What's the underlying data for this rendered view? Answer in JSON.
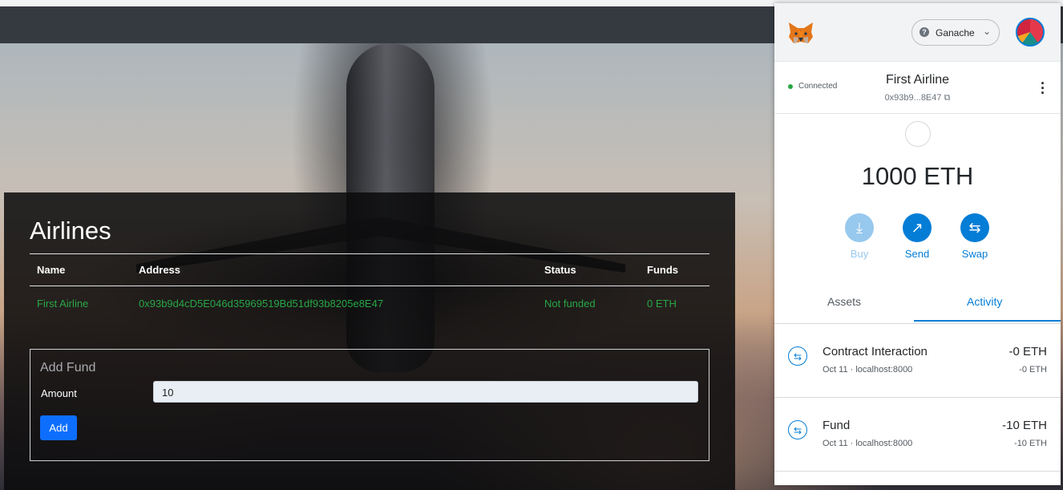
{
  "dapp": {
    "panel_title": "Airlines",
    "table": {
      "headers": [
        "Name",
        "Address",
        "Status",
        "Funds"
      ],
      "rows": [
        [
          "First Airline",
          "0x93b9d4cD5E046d35969519Bd51df93b8205e8E47",
          "Not funded",
          "0 ETH"
        ]
      ]
    },
    "add_fund": {
      "title": "Add Fund",
      "amount_label": "Amount",
      "amount_value": "10",
      "add_button": "Add"
    }
  },
  "metamask": {
    "network": "Ganache",
    "connection_status": "Connected",
    "account_name": "First Airline",
    "account_address": "0x93b9...8E47",
    "balance": "1000 ETH",
    "actions": [
      {
        "label": "Buy",
        "icon": "download-icon",
        "color": "#97c8ee"
      },
      {
        "label": "Send",
        "icon": "arrow-up-right-icon",
        "color": "#037dd6"
      },
      {
        "label": "Swap",
        "icon": "swap-icon",
        "color": "#037dd6"
      }
    ],
    "tabs": {
      "assets": "Assets",
      "activity": "Activity"
    },
    "activity": [
      {
        "title": "Contract Interaction",
        "meta": "Oct 11 · localhost:8000",
        "amount": "-0 ETH",
        "sub_amount": "-0 ETH"
      },
      {
        "title": "Fund",
        "meta": "Oct 11 · localhost:8000",
        "amount": "-10 ETH",
        "sub_amount": "-10 ETH"
      }
    ]
  },
  "colors": {
    "accent": "#037dd6",
    "success": "#28a745",
    "button_primary": "#0d6efd"
  }
}
